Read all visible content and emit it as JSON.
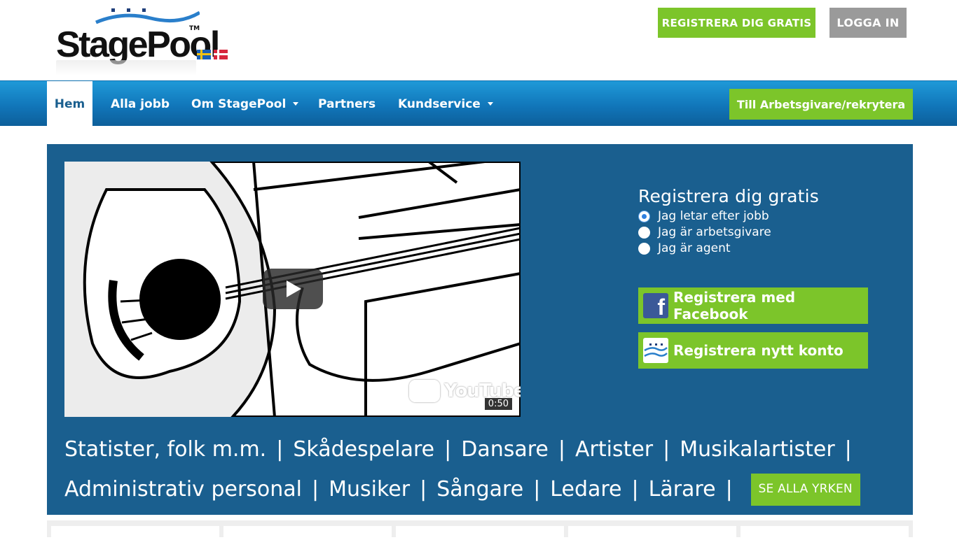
{
  "header": {
    "logo_text": "StagePool",
    "logo_tm": "TM",
    "register_button": "REGISTRERA DIG GRATIS",
    "login_button": "LOGGA IN"
  },
  "nav": {
    "items": [
      {
        "label": "Hem",
        "active": true
      },
      {
        "label": "Alla jobb"
      },
      {
        "label": "Om StagePool",
        "dropdown": true
      },
      {
        "label": "Partners"
      },
      {
        "label": "Kundservice",
        "dropdown": true
      }
    ],
    "employer_button": "Till Arbetsgivare/rekrytera"
  },
  "video": {
    "brand": "YouTube",
    "duration": "0:50"
  },
  "signup": {
    "title": "Registrera dig gratis",
    "options": [
      {
        "label": "Jag letar efter jobb",
        "checked": true
      },
      {
        "label": "Jag är arbetsgivare",
        "checked": false
      },
      {
        "label": "Jag är agent",
        "checked": false
      }
    ],
    "facebook_button": "Registrera med Facebook",
    "new_account_button": "Registrera nytt konto"
  },
  "professions": {
    "line1": [
      "Statister, folk m.m.",
      "Skådespelare",
      "Dansare",
      "Artister",
      "Musikalartister"
    ],
    "line2": [
      "Administrativ personal",
      "Musiker",
      "Sångare",
      "Ledare",
      "Lärare"
    ],
    "separator": "|",
    "see_all_button": "SE ALLA YRKEN"
  },
  "colors": {
    "green": "#7cc52a",
    "blue_dark": "#1a5f8f",
    "nav_blue": "#1176ba",
    "grey_button": "#9a9a9a"
  }
}
